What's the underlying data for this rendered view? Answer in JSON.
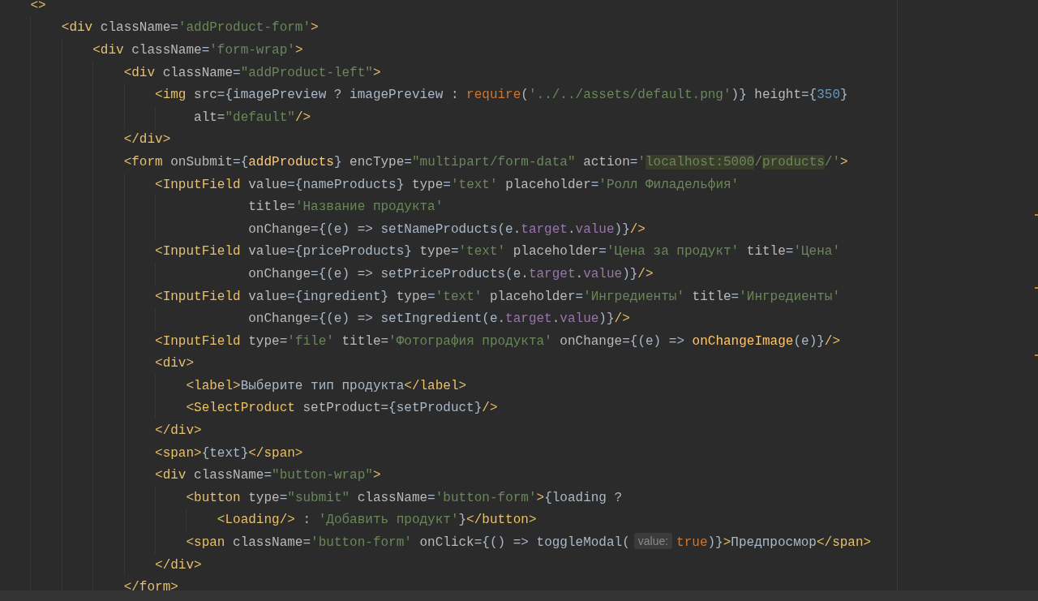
{
  "editor": {
    "lines": [
      {
        "tokens": [
          {
            "kind": "tag",
            "text": "<>"
          }
        ],
        "children": [
          {
            "tokens": [
              {
                "kind": "tag",
                "text": "<div"
              },
              {
                "kind": "attr",
                "text": " className"
              },
              {
                "kind": "punct",
                "text": "="
              },
              {
                "kind": "str",
                "text": "'addProduct-form'"
              },
              {
                "kind": "tag",
                "text": ">"
              }
            ],
            "children": [
              {
                "tokens": [
                  {
                    "kind": "tag",
                    "text": "<div"
                  },
                  {
                    "kind": "attr",
                    "text": " className"
                  },
                  {
                    "kind": "punct",
                    "text": "="
                  },
                  {
                    "kind": "str",
                    "text": "'form-wrap'"
                  },
                  {
                    "kind": "tag",
                    "text": ">"
                  }
                ],
                "children": [
                  {
                    "tokens": [
                      {
                        "kind": "tag",
                        "text": "<div"
                      },
                      {
                        "kind": "attr",
                        "text": " className"
                      },
                      {
                        "kind": "punct",
                        "text": "="
                      },
                      {
                        "kind": "str",
                        "text": "\"addProduct-left\""
                      },
                      {
                        "kind": "tag",
                        "text": ">"
                      }
                    ],
                    "children": [
                      {
                        "tokens": [
                          {
                            "kind": "tag",
                            "text": "<img"
                          },
                          {
                            "kind": "attr",
                            "text": " src"
                          },
                          {
                            "kind": "punct",
                            "text": "={imagePreview ? imagePreview : "
                          },
                          {
                            "kind": "kw",
                            "text": "require"
                          },
                          {
                            "kind": "punct",
                            "text": "("
                          },
                          {
                            "kind": "str",
                            "text": "'../../assets/default.png'"
                          },
                          {
                            "kind": "punct",
                            "text": ")}"
                          },
                          {
                            "kind": "attr",
                            "text": " height"
                          },
                          {
                            "kind": "punct",
                            "text": "={"
                          },
                          {
                            "kind": "num",
                            "text": "350"
                          },
                          {
                            "kind": "punct",
                            "text": "}"
                          }
                        ],
                        "continuation": [
                          {
                            "tokens": [
                              {
                                "kind": "attr",
                                "text": "alt"
                              },
                              {
                                "kind": "punct",
                                "text": "="
                              },
                              {
                                "kind": "str",
                                "text": "\"default\""
                              },
                              {
                                "kind": "tag",
                                "text": "/>"
                              }
                            ]
                          }
                        ]
                      }
                    ]
                  },
                  {
                    "tokens": [
                      {
                        "kind": "tag",
                        "text": "</div>"
                      }
                    ]
                  },
                  {
                    "tokens": [
                      {
                        "kind": "tag",
                        "text": "<form"
                      },
                      {
                        "kind": "attr",
                        "text": " onSubmit"
                      },
                      {
                        "kind": "punct",
                        "text": "={"
                      },
                      {
                        "kind": "fn",
                        "text": "addProducts"
                      },
                      {
                        "kind": "punct",
                        "text": "}"
                      },
                      {
                        "kind": "attr",
                        "text": " encType"
                      },
                      {
                        "kind": "punct",
                        "text": "="
                      },
                      {
                        "kind": "str",
                        "text": "\"multipart/form-data\""
                      },
                      {
                        "kind": "attr",
                        "text": " action"
                      },
                      {
                        "kind": "punct",
                        "text": "="
                      },
                      {
                        "kind": "str",
                        "text": "'"
                      },
                      {
                        "kind": "highlight",
                        "text": "localhost:5000"
                      },
                      {
                        "kind": "str",
                        "text": "/"
                      },
                      {
                        "kind": "highlight",
                        "text": "products"
                      },
                      {
                        "kind": "str",
                        "text": "/'"
                      },
                      {
                        "kind": "tag",
                        "text": ">"
                      }
                    ],
                    "children": [
                      {
                        "tokens": [
                          {
                            "kind": "tag",
                            "text": "<InputField"
                          },
                          {
                            "kind": "attr",
                            "text": " value"
                          },
                          {
                            "kind": "punct",
                            "text": "={nameProducts}"
                          },
                          {
                            "kind": "attr",
                            "text": " type"
                          },
                          {
                            "kind": "punct",
                            "text": "="
                          },
                          {
                            "kind": "str",
                            "text": "'text'"
                          },
                          {
                            "kind": "attr",
                            "text": " placeholder"
                          },
                          {
                            "kind": "punct",
                            "text": "="
                          },
                          {
                            "kind": "str",
                            "text": "'Ролл Филадельфия'"
                          }
                        ],
                        "continuation": [
                          {
                            "tokens": [
                              {
                                "kind": "attr",
                                "text": "title"
                              },
                              {
                                "kind": "punct",
                                "text": "="
                              },
                              {
                                "kind": "str",
                                "text": "'Название продукта'"
                              }
                            ]
                          },
                          {
                            "tokens": [
                              {
                                "kind": "attr",
                                "text": "onChange"
                              },
                              {
                                "kind": "punct",
                                "text": "={(e) => setNameProducts(e."
                              },
                              {
                                "kind": "prop",
                                "text": "target"
                              },
                              {
                                "kind": "punct",
                                "text": "."
                              },
                              {
                                "kind": "prop",
                                "text": "value"
                              },
                              {
                                "kind": "punct",
                                "text": ")}"
                              },
                              {
                                "kind": "tag",
                                "text": "/>"
                              }
                            ]
                          }
                        ]
                      },
                      {
                        "tokens": [
                          {
                            "kind": "tag",
                            "text": "<InputField"
                          },
                          {
                            "kind": "attr",
                            "text": " value"
                          },
                          {
                            "kind": "punct",
                            "text": "={priceProducts}"
                          },
                          {
                            "kind": "attr",
                            "text": " type"
                          },
                          {
                            "kind": "punct",
                            "text": "="
                          },
                          {
                            "kind": "str",
                            "text": "'text'"
                          },
                          {
                            "kind": "attr",
                            "text": " placeholder"
                          },
                          {
                            "kind": "punct",
                            "text": "="
                          },
                          {
                            "kind": "str",
                            "text": "'Цена за продукт'"
                          },
                          {
                            "kind": "attr",
                            "text": " title"
                          },
                          {
                            "kind": "punct",
                            "text": "="
                          },
                          {
                            "kind": "str",
                            "text": "'Цена'"
                          }
                        ],
                        "continuation": [
                          {
                            "tokens": [
                              {
                                "kind": "attr",
                                "text": "onChange"
                              },
                              {
                                "kind": "punct",
                                "text": "={(e) => setPriceProducts(e."
                              },
                              {
                                "kind": "prop",
                                "text": "target"
                              },
                              {
                                "kind": "punct",
                                "text": "."
                              },
                              {
                                "kind": "prop",
                                "text": "value"
                              },
                              {
                                "kind": "punct",
                                "text": ")}"
                              },
                              {
                                "kind": "tag",
                                "text": "/>"
                              }
                            ]
                          }
                        ]
                      },
                      {
                        "tokens": [
                          {
                            "kind": "tag",
                            "text": "<InputField"
                          },
                          {
                            "kind": "attr",
                            "text": " value"
                          },
                          {
                            "kind": "punct",
                            "text": "={ingredient}"
                          },
                          {
                            "kind": "attr",
                            "text": " type"
                          },
                          {
                            "kind": "punct",
                            "text": "="
                          },
                          {
                            "kind": "str",
                            "text": "'text'"
                          },
                          {
                            "kind": "attr",
                            "text": " placeholder"
                          },
                          {
                            "kind": "punct",
                            "text": "="
                          },
                          {
                            "kind": "str",
                            "text": "'Ингредиенты'"
                          },
                          {
                            "kind": "attr",
                            "text": " title"
                          },
                          {
                            "kind": "punct",
                            "text": "="
                          },
                          {
                            "kind": "str",
                            "text": "'Ингредиенты'"
                          }
                        ],
                        "continuation": [
                          {
                            "tokens": [
                              {
                                "kind": "attr",
                                "text": "onChange"
                              },
                              {
                                "kind": "punct",
                                "text": "={(e) => setIngredient(e."
                              },
                              {
                                "kind": "prop",
                                "text": "target"
                              },
                              {
                                "kind": "punct",
                                "text": "."
                              },
                              {
                                "kind": "prop",
                                "text": "value"
                              },
                              {
                                "kind": "punct",
                                "text": ")}"
                              },
                              {
                                "kind": "tag",
                                "text": "/>"
                              }
                            ]
                          }
                        ]
                      },
                      {
                        "tokens": [
                          {
                            "kind": "tag",
                            "text": "<InputField"
                          },
                          {
                            "kind": "attr",
                            "text": " type"
                          },
                          {
                            "kind": "punct",
                            "text": "="
                          },
                          {
                            "kind": "str",
                            "text": "'file'"
                          },
                          {
                            "kind": "attr",
                            "text": " title"
                          },
                          {
                            "kind": "punct",
                            "text": "="
                          },
                          {
                            "kind": "str",
                            "text": "'Фотография продукта'"
                          },
                          {
                            "kind": "attr",
                            "text": " onChange"
                          },
                          {
                            "kind": "punct",
                            "text": "={(e) => "
                          },
                          {
                            "kind": "fn",
                            "text": "onChangeImage"
                          },
                          {
                            "kind": "punct",
                            "text": "(e)}"
                          },
                          {
                            "kind": "tag",
                            "text": "/>"
                          }
                        ]
                      },
                      {
                        "tokens": [
                          {
                            "kind": "tag",
                            "text": "<div>"
                          }
                        ],
                        "children": [
                          {
                            "tokens": [
                              {
                                "kind": "tag",
                                "text": "<label>"
                              },
                              {
                                "kind": "text",
                                "text": "Выберите тип продукта"
                              },
                              {
                                "kind": "tag",
                                "text": "</label>"
                              }
                            ]
                          },
                          {
                            "tokens": [
                              {
                                "kind": "tag",
                                "text": "<SelectProduct"
                              },
                              {
                                "kind": "attr",
                                "text": " setProduct"
                              },
                              {
                                "kind": "punct",
                                "text": "={setProduct}"
                              },
                              {
                                "kind": "tag",
                                "text": "/>"
                              }
                            ]
                          }
                        ]
                      },
                      {
                        "tokens": [
                          {
                            "kind": "tag",
                            "text": "</div>"
                          }
                        ]
                      },
                      {
                        "tokens": [
                          {
                            "kind": "tag",
                            "text": "<span>"
                          },
                          {
                            "kind": "punct",
                            "text": "{text}"
                          },
                          {
                            "kind": "tag",
                            "text": "</span>"
                          }
                        ]
                      },
                      {
                        "tokens": [
                          {
                            "kind": "tag",
                            "text": "<div"
                          },
                          {
                            "kind": "attr",
                            "text": " className"
                          },
                          {
                            "kind": "punct",
                            "text": "="
                          },
                          {
                            "kind": "str",
                            "text": "\"button-wrap\""
                          },
                          {
                            "kind": "tag",
                            "text": ">"
                          }
                        ],
                        "children": [
                          {
                            "tokens": [
                              {
                                "kind": "tag",
                                "text": "<button"
                              },
                              {
                                "kind": "attr",
                                "text": " type"
                              },
                              {
                                "kind": "punct",
                                "text": "="
                              },
                              {
                                "kind": "str",
                                "text": "\"submit\""
                              },
                              {
                                "kind": "attr",
                                "text": " className"
                              },
                              {
                                "kind": "punct",
                                "text": "="
                              },
                              {
                                "kind": "str",
                                "text": "'button-form'"
                              },
                              {
                                "kind": "tag",
                                "text": ">"
                              },
                              {
                                "kind": "punct",
                                "text": "{loading ?"
                              }
                            ],
                            "children": [
                              {
                                "tokens": [
                                  {
                                    "kind": "tag",
                                    "text": "<Loading/>"
                                  },
                                  {
                                    "kind": "punct",
                                    "text": " : "
                                  },
                                  {
                                    "kind": "str",
                                    "text": "'Добавить продукт'"
                                  },
                                  {
                                    "kind": "punct",
                                    "text": "}"
                                  },
                                  {
                                    "kind": "tag",
                                    "text": "</button>"
                                  }
                                ]
                              }
                            ]
                          },
                          {
                            "tokens": [
                              {
                                "kind": "tag",
                                "text": "<span"
                              },
                              {
                                "kind": "attr",
                                "text": " className"
                              },
                              {
                                "kind": "punct",
                                "text": "="
                              },
                              {
                                "kind": "str",
                                "text": "'button-form'"
                              },
                              {
                                "kind": "attr",
                                "text": " onClick"
                              },
                              {
                                "kind": "punct",
                                "text": "={() => toggleModal("
                              },
                              {
                                "kind": "hint",
                                "text": "value:"
                              },
                              {
                                "kind": "kw",
                                "text": "true"
                              },
                              {
                                "kind": "punct",
                                "text": ")}"
                              },
                              {
                                "kind": "tag",
                                "text": ">"
                              },
                              {
                                "kind": "text",
                                "text": "Предпросмор"
                              },
                              {
                                "kind": "tag",
                                "text": "</span>"
                              }
                            ]
                          }
                        ]
                      },
                      {
                        "tokens": [
                          {
                            "kind": "tag",
                            "text": "</div>"
                          }
                        ]
                      }
                    ]
                  },
                  {
                    "tokens": [
                      {
                        "kind": "tag",
                        "text": "</form>"
                      }
                    ]
                  }
                ]
              }
            ]
          }
        ]
      }
    ]
  }
}
